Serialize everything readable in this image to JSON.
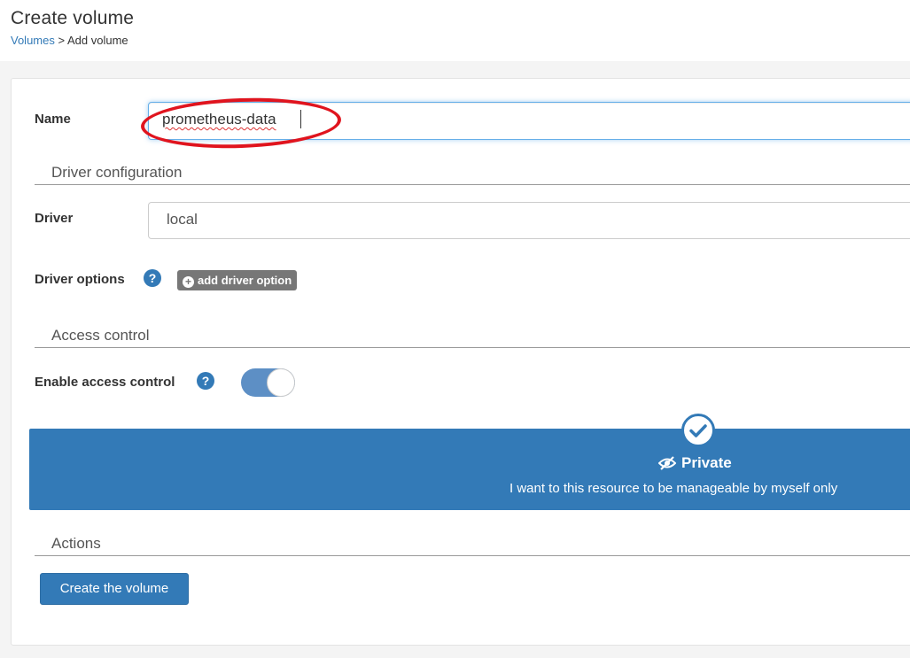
{
  "header": {
    "title": "Create volume",
    "breadcrumb": {
      "link": "Volumes",
      "separator": " > ",
      "current": "Add volume"
    }
  },
  "form": {
    "name": {
      "label": "Name",
      "value": "prometheus-data"
    },
    "driver_section": {
      "title": "Driver configuration"
    },
    "driver": {
      "label": "Driver",
      "value": "local"
    },
    "driver_options": {
      "label": "Driver options",
      "help": "?",
      "add_button": "add driver option"
    },
    "access_section": {
      "title": "Access control"
    },
    "access_control": {
      "label": "Enable access control",
      "help": "?",
      "enabled": true
    },
    "access_option": {
      "title": "Private",
      "description": "I want to this resource to be manageable by myself only",
      "icon": "eye-slash-icon",
      "selected": true
    },
    "actions_section": {
      "title": "Actions"
    },
    "submit_label": "Create the volume"
  },
  "colors": {
    "primary": "#337ab7",
    "highlight": "#e0141e",
    "secondary_button": "#777777"
  }
}
